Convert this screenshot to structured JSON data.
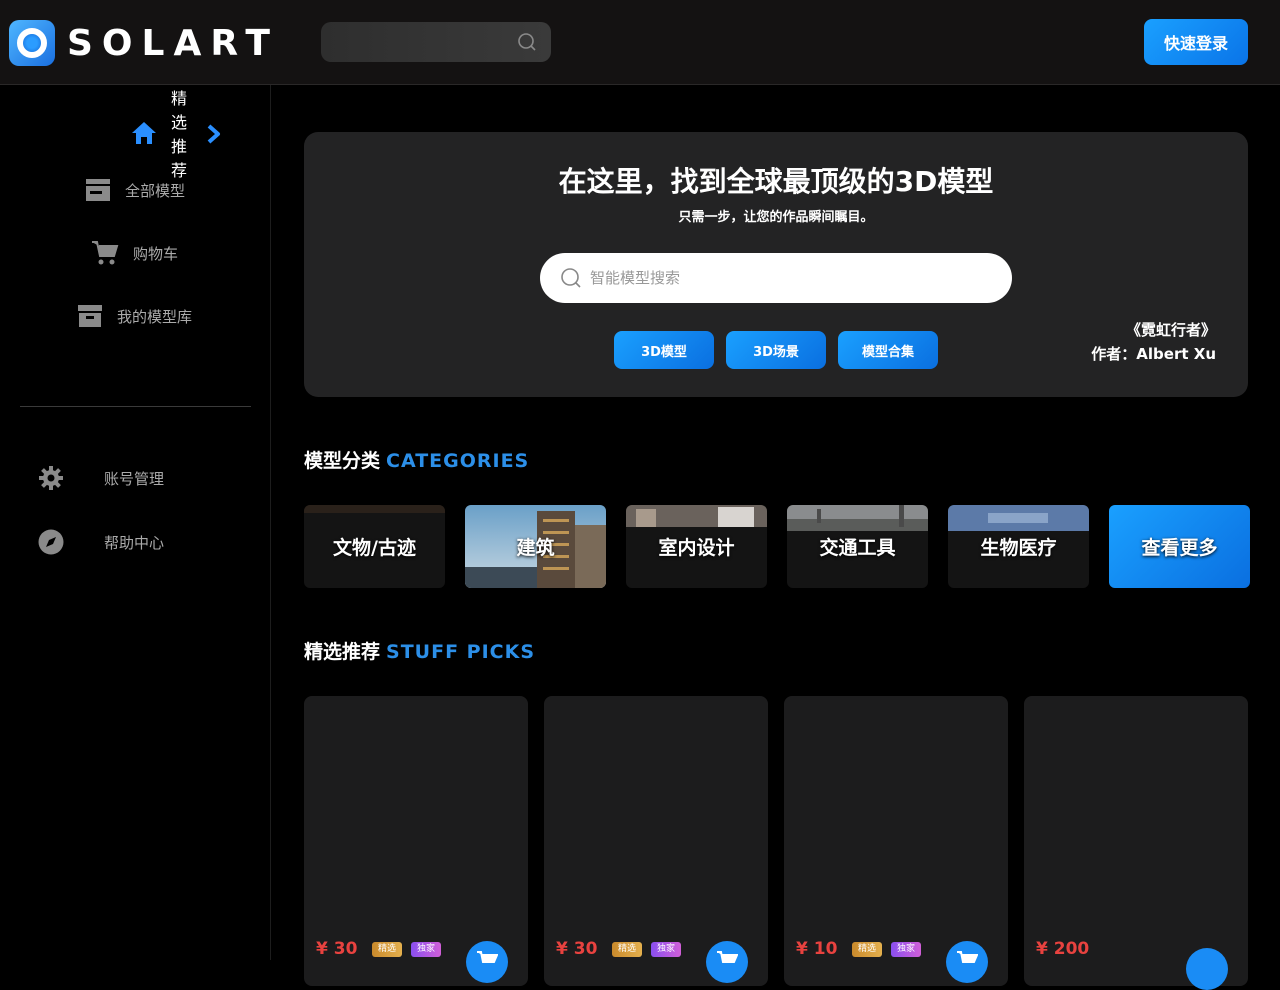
{
  "header": {
    "logo_text": "SOLART",
    "search_placeholder": "",
    "login_label": "快速登录"
  },
  "sidebar": {
    "active_label": "精\n选\n推\n荐",
    "items": [
      {
        "label": "全部模型",
        "icon": "store-icon"
      },
      {
        "label": "购物车",
        "icon": "cart-icon"
      },
      {
        "label": "我的模型库",
        "icon": "archive-icon"
      }
    ],
    "bottom_items": [
      {
        "label": "账号管理",
        "icon": "gear-icon"
      },
      {
        "label": "帮助中心",
        "icon": "compass-icon"
      }
    ]
  },
  "hero": {
    "title": "在这里，找到全球最顶级的3D模型",
    "subtitle": "只需一步，让您的作品瞬间瞩目。",
    "search_placeholder": "智能模型搜索",
    "chips": [
      "3D模型",
      "3D场景",
      "模型合集"
    ],
    "credit_title": "《霓虹行者》",
    "credit_author": "作者：Albert Xu"
  },
  "categories": {
    "title_cn": "模型分类",
    "title_en": "CATEGORIES",
    "items": [
      "文物/古迹",
      "建筑",
      "室内设计",
      "交通工具",
      "生物医疗"
    ],
    "more_label": "查看更多"
  },
  "picks": {
    "title_cn": "精选推荐",
    "title_en": "STUFF PICKS",
    "cards": [
      {
        "price": "¥ 30",
        "tags": [
          "精选",
          "独家"
        ]
      },
      {
        "price": "¥ 30",
        "tags": [
          "精选",
          "独家"
        ]
      },
      {
        "price": "¥ 10",
        "tags": [
          "精选",
          "独家"
        ]
      },
      {
        "price": "¥ 200",
        "tags": []
      }
    ]
  },
  "colors": {
    "accent": "#1a8cf5",
    "price": "#e8423f",
    "background": "#000000",
    "panel": "#232324"
  }
}
